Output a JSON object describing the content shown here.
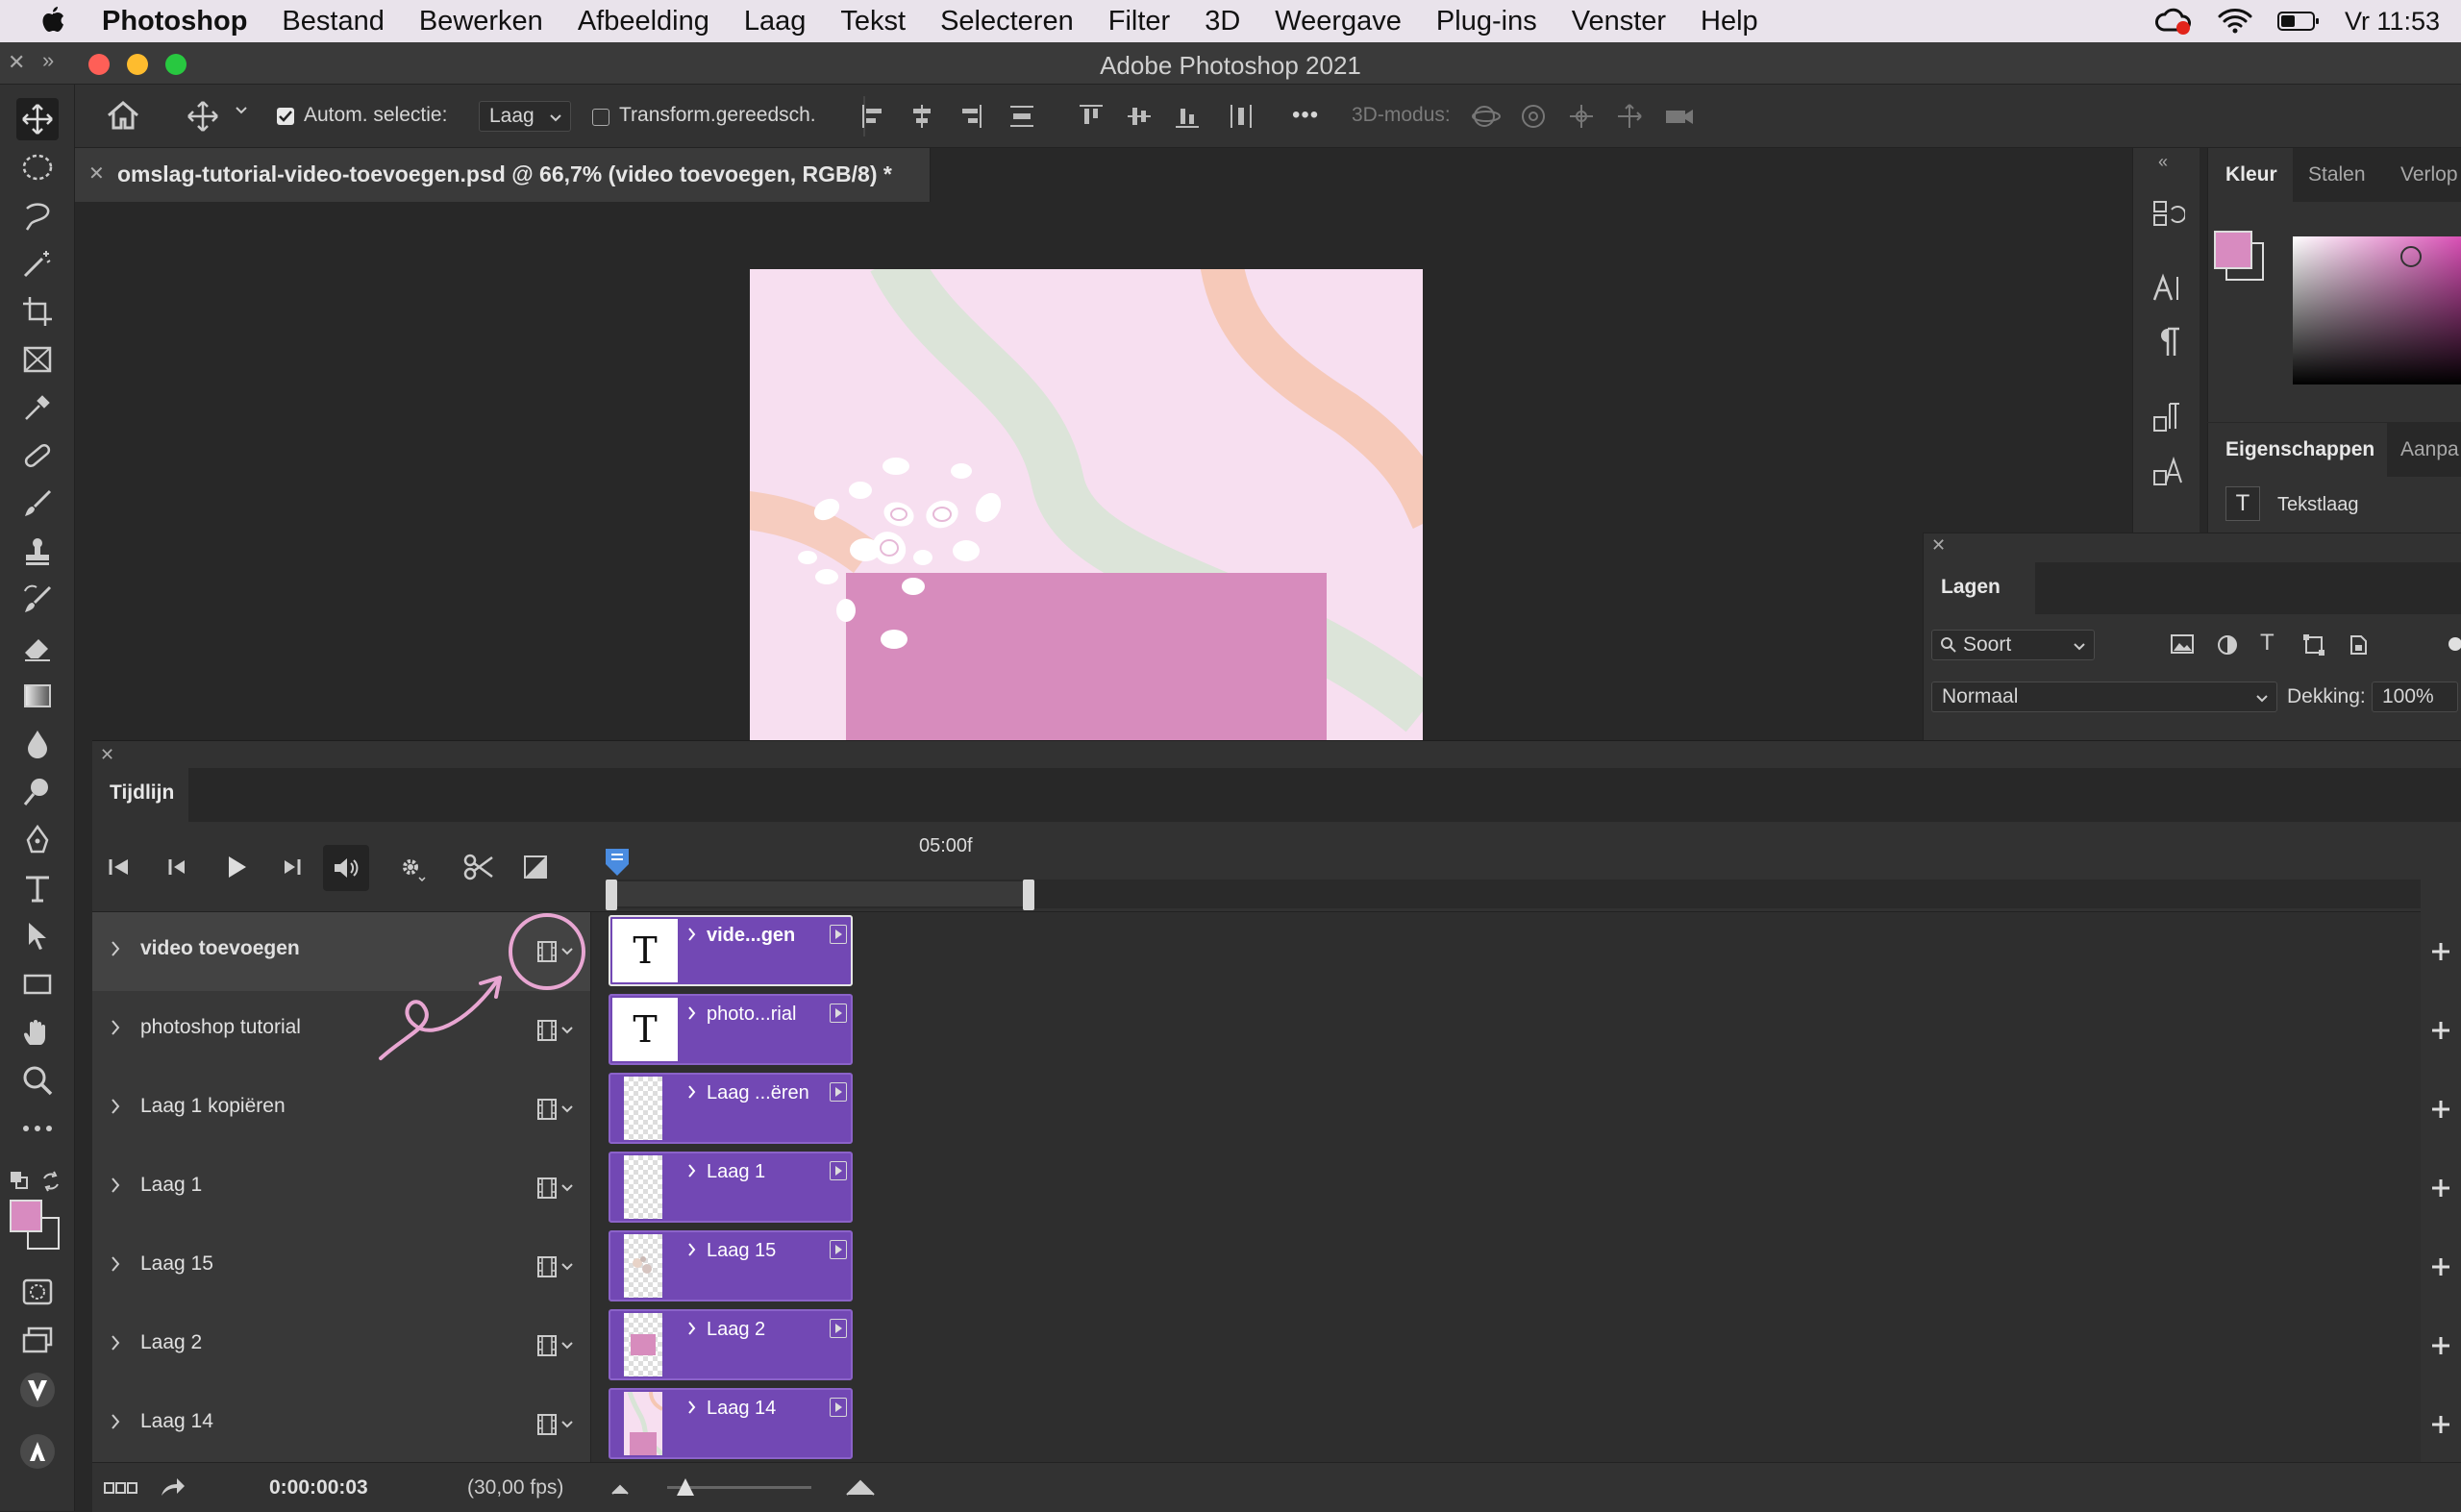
{
  "menubar": {
    "app": "Photoshop",
    "items": [
      "Bestand",
      "Bewerken",
      "Afbeelding",
      "Laag",
      "Tekst",
      "Selecteren",
      "Filter",
      "3D",
      "Weergave",
      "Plug-ins",
      "Venster",
      "Help"
    ],
    "clock": "Vr 11:53"
  },
  "window": {
    "title": "Adobe Photoshop 2021"
  },
  "options": {
    "auto_select_label": "Autom. selectie:",
    "auto_select_checked": true,
    "target_value": "Laag",
    "transform_label": "Transform.gereedsch.",
    "transform_checked": false,
    "more": "•••",
    "mode3d_label": "3D-modus:"
  },
  "document": {
    "tab_title": "omslag-tutorial-video-toevoegen.psd @ 66,7% (video toevoegen, RGB/8) *"
  },
  "panels": {
    "kleur_tabs": [
      "Kleur",
      "Stalen",
      "Verlop"
    ],
    "eig_tabs": [
      "Eigenschappen",
      "Aanpa"
    ],
    "eig_layer_type": "Tekstlaag",
    "lagen_title": "Lagen",
    "lagen_filter": "Soort",
    "blend_mode": "Normaal",
    "opacity_label": "Dekking:",
    "opacity_value": "100%"
  },
  "timeline": {
    "title": "Tijdlijn",
    "ruler_label": "05:00f",
    "current_time": "0:00:00:03",
    "fps": "(30,00 fps)",
    "layers": [
      {
        "name": "video toevoegen",
        "clip": "vide...gen",
        "thumb": "text",
        "selected": true
      },
      {
        "name": "photoshop tutorial",
        "clip": "photo...rial",
        "thumb": "text",
        "selected": false
      },
      {
        "name": "Laag 1 kopiëren",
        "clip": "Laag ...ëren",
        "thumb": "transparent",
        "selected": false
      },
      {
        "name": "Laag 1",
        "clip": "Laag 1",
        "thumb": "transparent",
        "selected": false
      },
      {
        "name": "Laag 15",
        "clip": "Laag 15",
        "thumb": "flowers",
        "selected": false
      },
      {
        "name": "Laag 2",
        "clip": "Laag 2",
        "thumb": "pink-rect",
        "selected": false
      },
      {
        "name": "Laag 14",
        "clip": "Laag 14",
        "thumb": "background",
        "selected": false
      }
    ]
  },
  "colors": {
    "foreground": "#d88bc0",
    "clip": "#7248b4",
    "annotation": "#e8a6d2",
    "artboard_bg": "#f7dff0",
    "pink_block": "#d78cbd"
  }
}
